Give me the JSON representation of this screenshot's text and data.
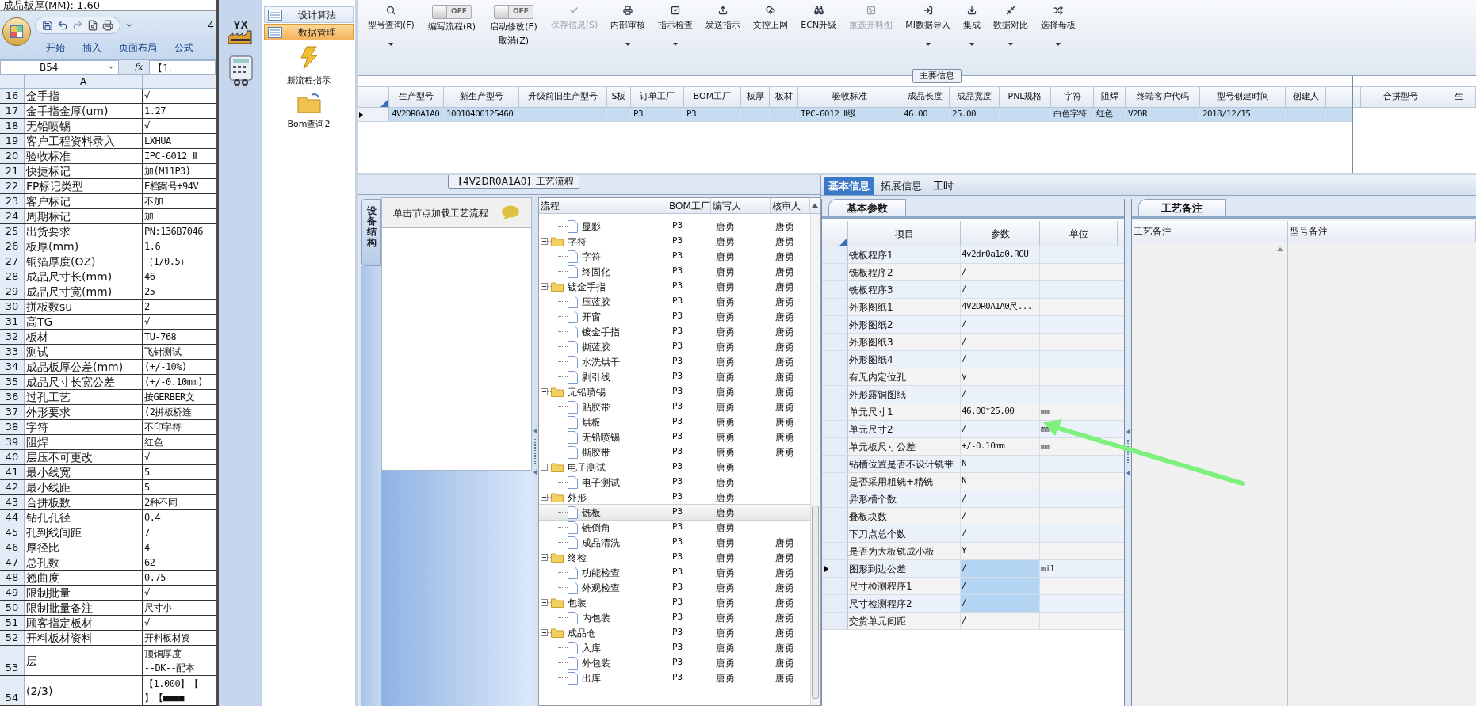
{
  "excel": {
    "top_line": "成品板厚(MM): 1.60",
    "title_fragment": "4",
    "ribbon_tabs": [
      "开始",
      "插入",
      "页面布局",
      "公式"
    ],
    "name_box": "B54",
    "function_label": "fx",
    "formula": "【1.",
    "column_header": "A",
    "rows": [
      {
        "num": "16",
        "a": "金手指",
        "b": [
          "√"
        ]
      },
      {
        "num": "17",
        "a": "金手指金厚(um)",
        "b": [
          "1.27"
        ]
      },
      {
        "num": "18",
        "a": "无铅喷锡",
        "b": [
          "√"
        ]
      },
      {
        "num": "19",
        "a": "客户工程资料录入",
        "b": [
          "LXHUA"
        ]
      },
      {
        "num": "20",
        "a": "验收标准",
        "b": [
          "IPC-6012 Ⅱ"
        ]
      },
      {
        "num": "21",
        "a": "快捷标记",
        "b": [
          "加(M11P3)"
        ]
      },
      {
        "num": "22",
        "a": "FP标记类型",
        "b": [
          "E档案号+94V"
        ]
      },
      {
        "num": "23",
        "a": "客户标记",
        "b": [
          "不加"
        ]
      },
      {
        "num": "24",
        "a": "周期标记",
        "b": [
          "加"
        ]
      },
      {
        "num": "25",
        "a": "出货要求",
        "b": [
          "PN:136B7046"
        ]
      },
      {
        "num": "26",
        "a": "板厚(mm)",
        "b": [
          "1.6"
        ]
      },
      {
        "num": "27",
        "a": "铜箔厚度(OZ)",
        "b": [
          "（1/0.5）"
        ]
      },
      {
        "num": "28",
        "a": "成品尺寸长(mm)",
        "b": [
          "46"
        ]
      },
      {
        "num": "29",
        "a": "成品尺寸宽(mm)",
        "b": [
          "25"
        ]
      },
      {
        "num": "30",
        "a": "拼板数su",
        "b": [
          "2"
        ]
      },
      {
        "num": "31",
        "a": "高TG",
        "b": [
          "√"
        ]
      },
      {
        "num": "32",
        "a": "板材",
        "b": [
          "TU-768"
        ]
      },
      {
        "num": "33",
        "a": "测试",
        "b": [
          "飞针测试"
        ]
      },
      {
        "num": "34",
        "a": "成品板厚公差(mm)",
        "b": [
          "(+/-10%)"
        ]
      },
      {
        "num": "35",
        "a": "成品尺寸长宽公差",
        "b": [
          "(+/-0.10mm)"
        ]
      },
      {
        "num": "36",
        "a": "过孔工艺",
        "b": [
          "按GERBER文"
        ]
      },
      {
        "num": "37",
        "a": "外形要求",
        "b": [
          "(2拼板桥连"
        ]
      },
      {
        "num": "38",
        "a": "字符",
        "b": [
          "不印字符"
        ]
      },
      {
        "num": "39",
        "a": "阻焊",
        "b": [
          "红色"
        ]
      },
      {
        "num": "40",
        "a": "层压不可更改",
        "b": [
          "√"
        ]
      },
      {
        "num": "41",
        "a": "最小线宽",
        "b": [
          "5"
        ]
      },
      {
        "num": "42",
        "a": "最小线距",
        "b": [
          "5"
        ]
      },
      {
        "num": "43",
        "a": "合拼板数",
        "b": [
          "2种不同"
        ]
      },
      {
        "num": "44",
        "a": "钻孔孔径",
        "b": [
          "0.4"
        ]
      },
      {
        "num": "45",
        "a": "孔到线间距",
        "b": [
          "7"
        ]
      },
      {
        "num": "46",
        "a": "厚径比",
        "b": [
          "4"
        ]
      },
      {
        "num": "47",
        "a": "总孔数",
        "b": [
          "62"
        ]
      },
      {
        "num": "48",
        "a": "翘曲度",
        "b": [
          "0.75"
        ]
      },
      {
        "num": "49",
        "a": "限制批量",
        "b": [
          "√"
        ]
      },
      {
        "num": "50",
        "a": "限制批量备注",
        "b": [
          "尺寸小"
        ]
      },
      {
        "num": "51",
        "a": "顾客指定板材",
        "b": [
          "√"
        ]
      },
      {
        "num": "52",
        "a": "开料板材资料",
        "b": [
          "开料板材资"
        ]
      },
      {
        "num": "53",
        "a": "层",
        "b": [
          "顶铜厚度--",
          "--DK--配本"
        ]
      },
      {
        "num": "54",
        "a": "(2/3)",
        "b": [
          "【1.000】【",
          "】【■■■■"
        ]
      }
    ]
  },
  "rail": {
    "logo_text": "YX"
  },
  "menu": {
    "items": [
      {
        "label": "设计算法",
        "selected": false
      },
      {
        "label": "数据管理",
        "selected": true
      }
    ],
    "tiles": [
      {
        "label": "新流程指示",
        "kind": "bolt"
      },
      {
        "label": "Bom查询2",
        "kind": "folder"
      }
    ]
  },
  "toolbar": [
    {
      "kind": "button",
      "lines": [
        "型号查询(F)"
      ],
      "disabled": false,
      "dropdown": true
    },
    {
      "kind": "toggle",
      "lines": [
        "编写流程(R)"
      ],
      "on": false,
      "switch_text": "OFF"
    },
    {
      "kind": "toggle",
      "lines": [
        "启动修改(E)",
        "取消(Z)"
      ],
      "on": false,
      "switch_text": "OFF"
    },
    {
      "kind": "button",
      "lines": [
        "保存信息(S)"
      ],
      "disabled": true,
      "dropdown": false
    },
    {
      "kind": "button",
      "lines": [
        "内部审核"
      ],
      "disabled": false,
      "dropdown": true
    },
    {
      "kind": "button",
      "lines": [
        "指示检查"
      ],
      "disabled": false,
      "dropdown": true
    },
    {
      "kind": "button",
      "lines": [
        "发送指示"
      ],
      "disabled": false,
      "dropdown": false
    },
    {
      "kind": "button",
      "lines": [
        "文控上网"
      ],
      "disabled": false,
      "dropdown": false
    },
    {
      "kind": "button",
      "lines": [
        "ECN升级"
      ],
      "disabled": false,
      "dropdown": false
    },
    {
      "kind": "button",
      "lines": [
        "重选开料图"
      ],
      "disabled": true,
      "dropdown": false
    },
    {
      "kind": "button",
      "lines": [
        "MI数据导入"
      ],
      "disabled": false,
      "dropdown": true
    },
    {
      "kind": "button",
      "lines": [
        "集成"
      ],
      "disabled": false,
      "dropdown": true
    },
    {
      "kind": "button",
      "lines": [
        "数据对比"
      ],
      "disabled": false,
      "dropdown": true
    },
    {
      "kind": "button",
      "lines": [
        "选择母板"
      ],
      "disabled": false,
      "dropdown": true
    }
  ],
  "main_info": {
    "title": "主要信息",
    "columns": [
      "生产型号",
      "新生产型号",
      "升级前旧生产型号",
      "S板",
      "订单工厂",
      "BOM工厂",
      "板厚",
      "板材",
      "验收标准",
      "成品长度",
      "成品宽度",
      "PNL规格",
      "字符",
      "阻焊",
      "终端客户代码",
      "型号创建时间",
      "创建人"
    ],
    "rows": [
      {
        "selected": true,
        "current": true,
        "cells": [
          "4V2DR0A1A0",
          "10010400125460",
          null,
          null,
          "P3",
          "P3",
          null,
          null,
          "IPC-6012 Ⅱ级",
          "46.00",
          "25.00",
          null,
          "白色字符",
          "红色",
          "V2DR",
          "2018/12/15",
          null
        ]
      }
    ],
    "side_columns": [
      "合拼型号",
      "生"
    ]
  },
  "process": {
    "title": "【4V2DR0A1A0】工艺流程",
    "side_tab": "设备结构",
    "hint": "单击节点加载工艺流程",
    "columns": [
      "流程",
      "BOM工厂",
      "编写人",
      "核审人"
    ],
    "nodes": [
      {
        "kind": "folder",
        "children": [
          {
            "kind": "leaf",
            "label": "显影",
            "bom": "P3",
            "writer": "唐勇",
            "reviewer": "唐勇",
            "selected": false
          }
        ]
      },
      {
        "kind": "folder",
        "label": "字符",
        "bom": "P3",
        "writer": "唐勇",
        "reviewer": "唐勇",
        "expanded": true,
        "selected": false,
        "children": [
          {
            "kind": "leaf",
            "label": "字符",
            "bom": "P3",
            "writer": "唐勇",
            "reviewer": "唐勇",
            "selected": false
          },
          {
            "kind": "leaf",
            "label": "终固化",
            "bom": "P3",
            "writer": "唐勇",
            "reviewer": "唐勇",
            "selected": false
          }
        ]
      },
      {
        "kind": "folder",
        "label": "镀金手指",
        "bom": "P3",
        "writer": "唐勇",
        "reviewer": "唐勇",
        "expanded": true,
        "selected": false,
        "children": [
          {
            "kind": "leaf",
            "label": "压蓝胶",
            "bom": "P3",
            "writer": "唐勇",
            "reviewer": "唐勇",
            "selected": false
          },
          {
            "kind": "leaf",
            "label": "开窗",
            "bom": "P3",
            "writer": "唐勇",
            "reviewer": "唐勇",
            "selected": false
          },
          {
            "kind": "leaf",
            "label": "镀金手指",
            "bom": "P3",
            "writer": "唐勇",
            "reviewer": "唐勇",
            "selected": false
          },
          {
            "kind": "leaf",
            "label": "撕蓝胶",
            "bom": "P3",
            "writer": "唐勇",
            "reviewer": "唐勇",
            "selected": false
          },
          {
            "kind": "leaf",
            "label": "水洗烘干",
            "bom": "P3",
            "writer": "唐勇",
            "reviewer": "唐勇",
            "selected": false
          },
          {
            "kind": "leaf",
            "label": "剥引线",
            "bom": "P3",
            "writer": "唐勇",
            "reviewer": "唐勇",
            "selected": false
          }
        ]
      },
      {
        "kind": "folder",
        "label": "无铅喷锡",
        "bom": "P3",
        "writer": "唐勇",
        "reviewer": "唐勇",
        "expanded": true,
        "selected": false,
        "children": [
          {
            "kind": "leaf",
            "label": "贴胶带",
            "bom": "P3",
            "writer": "唐勇",
            "reviewer": "唐勇",
            "selected": false
          },
          {
            "kind": "leaf",
            "label": "烘板",
            "bom": "P3",
            "writer": "唐勇",
            "reviewer": "唐勇",
            "selected": false
          },
          {
            "kind": "leaf",
            "label": "无铅喷锡",
            "bom": "P3",
            "writer": "唐勇",
            "reviewer": "唐勇",
            "selected": false
          },
          {
            "kind": "leaf",
            "label": "撕胶带",
            "bom": "P3",
            "writer": "唐勇",
            "reviewer": "唐勇",
            "selected": false
          }
        ]
      },
      {
        "kind": "folder",
        "label": "电子测试",
        "bom": "P3",
        "writer": "唐勇",
        "expanded": true,
        "selected": false,
        "children": [
          {
            "kind": "leaf",
            "label": "电子测试",
            "bom": "P3",
            "writer": "唐勇",
            "selected": false
          }
        ]
      },
      {
        "kind": "folder",
        "label": "外形",
        "bom": "P3",
        "writer": "唐勇",
        "expanded": true,
        "selected": false,
        "children": [
          {
            "kind": "leaf",
            "label": "铣板",
            "bom": "P3",
            "writer": "唐勇",
            "selected": true
          },
          {
            "kind": "leaf",
            "label": "铣倒角",
            "bom": "P3",
            "writer": "唐勇",
            "selected": false
          },
          {
            "kind": "leaf",
            "label": "成品清洗",
            "bom": "P3",
            "writer": "唐勇",
            "reviewer": "唐勇",
            "selected": false
          }
        ]
      },
      {
        "kind": "folder",
        "label": "终检",
        "bom": "P3",
        "writer": "唐勇",
        "reviewer": "唐勇",
        "expanded": true,
        "selected": false,
        "children": [
          {
            "kind": "leaf",
            "label": "功能检查",
            "bom": "P3",
            "writer": "唐勇",
            "reviewer": "唐勇",
            "selected": false
          },
          {
            "kind": "leaf",
            "label": "外观检查",
            "bom": "P3",
            "writer": "唐勇",
            "reviewer": "唐勇",
            "selected": false
          }
        ]
      },
      {
        "kind": "folder",
        "label": "包装",
        "bom": "P3",
        "writer": "唐勇",
        "reviewer": "唐勇",
        "expanded": true,
        "selected": false,
        "children": [
          {
            "kind": "leaf",
            "label": "内包装",
            "bom": "P3",
            "writer": "唐勇",
            "reviewer": "唐勇",
            "selected": false
          }
        ]
      },
      {
        "kind": "folder",
        "label": "成品仓",
        "bom": "P3",
        "writer": "唐勇",
        "reviewer": "唐勇",
        "expanded": true,
        "selected": false,
        "children": [
          {
            "kind": "leaf",
            "label": "入库",
            "bom": "P3",
            "writer": "唐勇",
            "reviewer": "唐勇",
            "selected": false
          },
          {
            "kind": "leaf",
            "label": "外包装",
            "bom": "P3",
            "writer": "唐勇",
            "reviewer": "唐勇",
            "selected": false
          },
          {
            "kind": "leaf",
            "label": "出库",
            "bom": "P3",
            "writer": "唐勇",
            "reviewer": "唐勇",
            "selected": false
          }
        ]
      }
    ]
  },
  "detail_tabs": [
    {
      "label": "基本信息",
      "selected": true
    },
    {
      "label": "拓展信息",
      "selected": false
    },
    {
      "label": "工时",
      "selected": false
    }
  ],
  "params": {
    "title": "基本参数",
    "columns": [
      "项目",
      "参数",
      "单位"
    ],
    "rows": [
      {
        "item": "铣板程序1",
        "value": "4v2dr0a1a0.ROU",
        "selected": false,
        "current": false
      },
      {
        "item": "铣板程序2",
        "value": "/",
        "selected": false,
        "current": false
      },
      {
        "item": "铣板程序3",
        "value": "/",
        "selected": false,
        "current": false
      },
      {
        "item": "外形图纸1",
        "value": "4V2DR0A1A0尺...",
        "selected": false,
        "current": false
      },
      {
        "item": "外形图纸2",
        "value": "/",
        "selected": false,
        "current": false
      },
      {
        "item": "外形图纸3",
        "value": "/",
        "selected": false,
        "current": false
      },
      {
        "item": "外形图纸4",
        "value": "/",
        "selected": false,
        "current": false
      },
      {
        "item": "有无内定位孔",
        "value": "y",
        "selected": false,
        "current": false
      },
      {
        "item": "外形露铜图纸",
        "value": "/",
        "selected": false,
        "current": false
      },
      {
        "item": "单元尺寸1",
        "value": "46.00*25.00",
        "unit": "mm",
        "selected": false,
        "current": false
      },
      {
        "item": "单元尺寸2",
        "value": "/",
        "unit": "mm",
        "selected": false,
        "current": false
      },
      {
        "item": "单元板尺寸公差",
        "value": "+/-0.10mm",
        "unit": "mm",
        "selected": false,
        "current": false
      },
      {
        "item": "钻槽位置是否不设计铣带",
        "value": "N",
        "selected": false,
        "current": false
      },
      {
        "item": "是否采用粗铣+精铣",
        "value": "N",
        "selected": false,
        "current": false
      },
      {
        "item": "异形槽个数",
        "value": "/",
        "selected": false,
        "current": false
      },
      {
        "item": "叠板块数",
        "value": "/",
        "selected": false,
        "current": false
      },
      {
        "item": "下刀点总个数",
        "value": "/",
        "selected": false,
        "current": false
      },
      {
        "item": "是否为大板铣成小板",
        "value": "Y",
        "selected": false,
        "current": false
      },
      {
        "item": "图形到边公差",
        "value": "/",
        "unit": "mil",
        "selected": true,
        "current": true
      },
      {
        "item": "尺寸检测程序1",
        "value": "/",
        "selected": true,
        "current": false
      },
      {
        "item": "尺寸检测程序2",
        "value": "/",
        "selected": true,
        "current": false
      },
      {
        "item": "交货单元间距",
        "value": "/",
        "selected": false,
        "current": false
      }
    ]
  },
  "remarks": {
    "title": "工艺备注",
    "columns": [
      "工艺备注",
      "型号备注"
    ]
  }
}
